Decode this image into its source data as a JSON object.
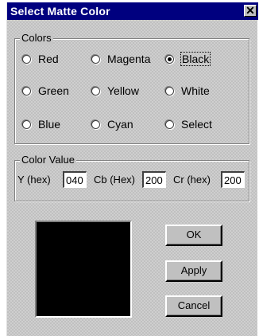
{
  "window": {
    "title": "Select Matte Color",
    "close_glyph": "✕"
  },
  "colors_group": {
    "label": "Colors",
    "options": [
      {
        "label": "Red",
        "checked": false
      },
      {
        "label": "Magenta",
        "checked": false
      },
      {
        "label": "Black",
        "checked": true
      },
      {
        "label": "Green",
        "checked": false
      },
      {
        "label": "Yellow",
        "checked": false
      },
      {
        "label": "White",
        "checked": false
      },
      {
        "label": "Blue",
        "checked": false
      },
      {
        "label": "Cyan",
        "checked": false
      },
      {
        "label": "Select",
        "checked": false
      }
    ]
  },
  "value_group": {
    "label": "Color Value",
    "y_label": "Y (hex)",
    "y_value": "040",
    "cb_label": "Cb (Hex)",
    "cb_value": "200",
    "cr_label": "Cr (hex)",
    "cr_value": "200"
  },
  "preview": {
    "color": "#000000"
  },
  "buttons": {
    "ok": "OK",
    "apply": "Apply",
    "cancel": "Cancel"
  },
  "colors": {
    "titlebar": "#00007f",
    "face": "#c0c0c0"
  }
}
